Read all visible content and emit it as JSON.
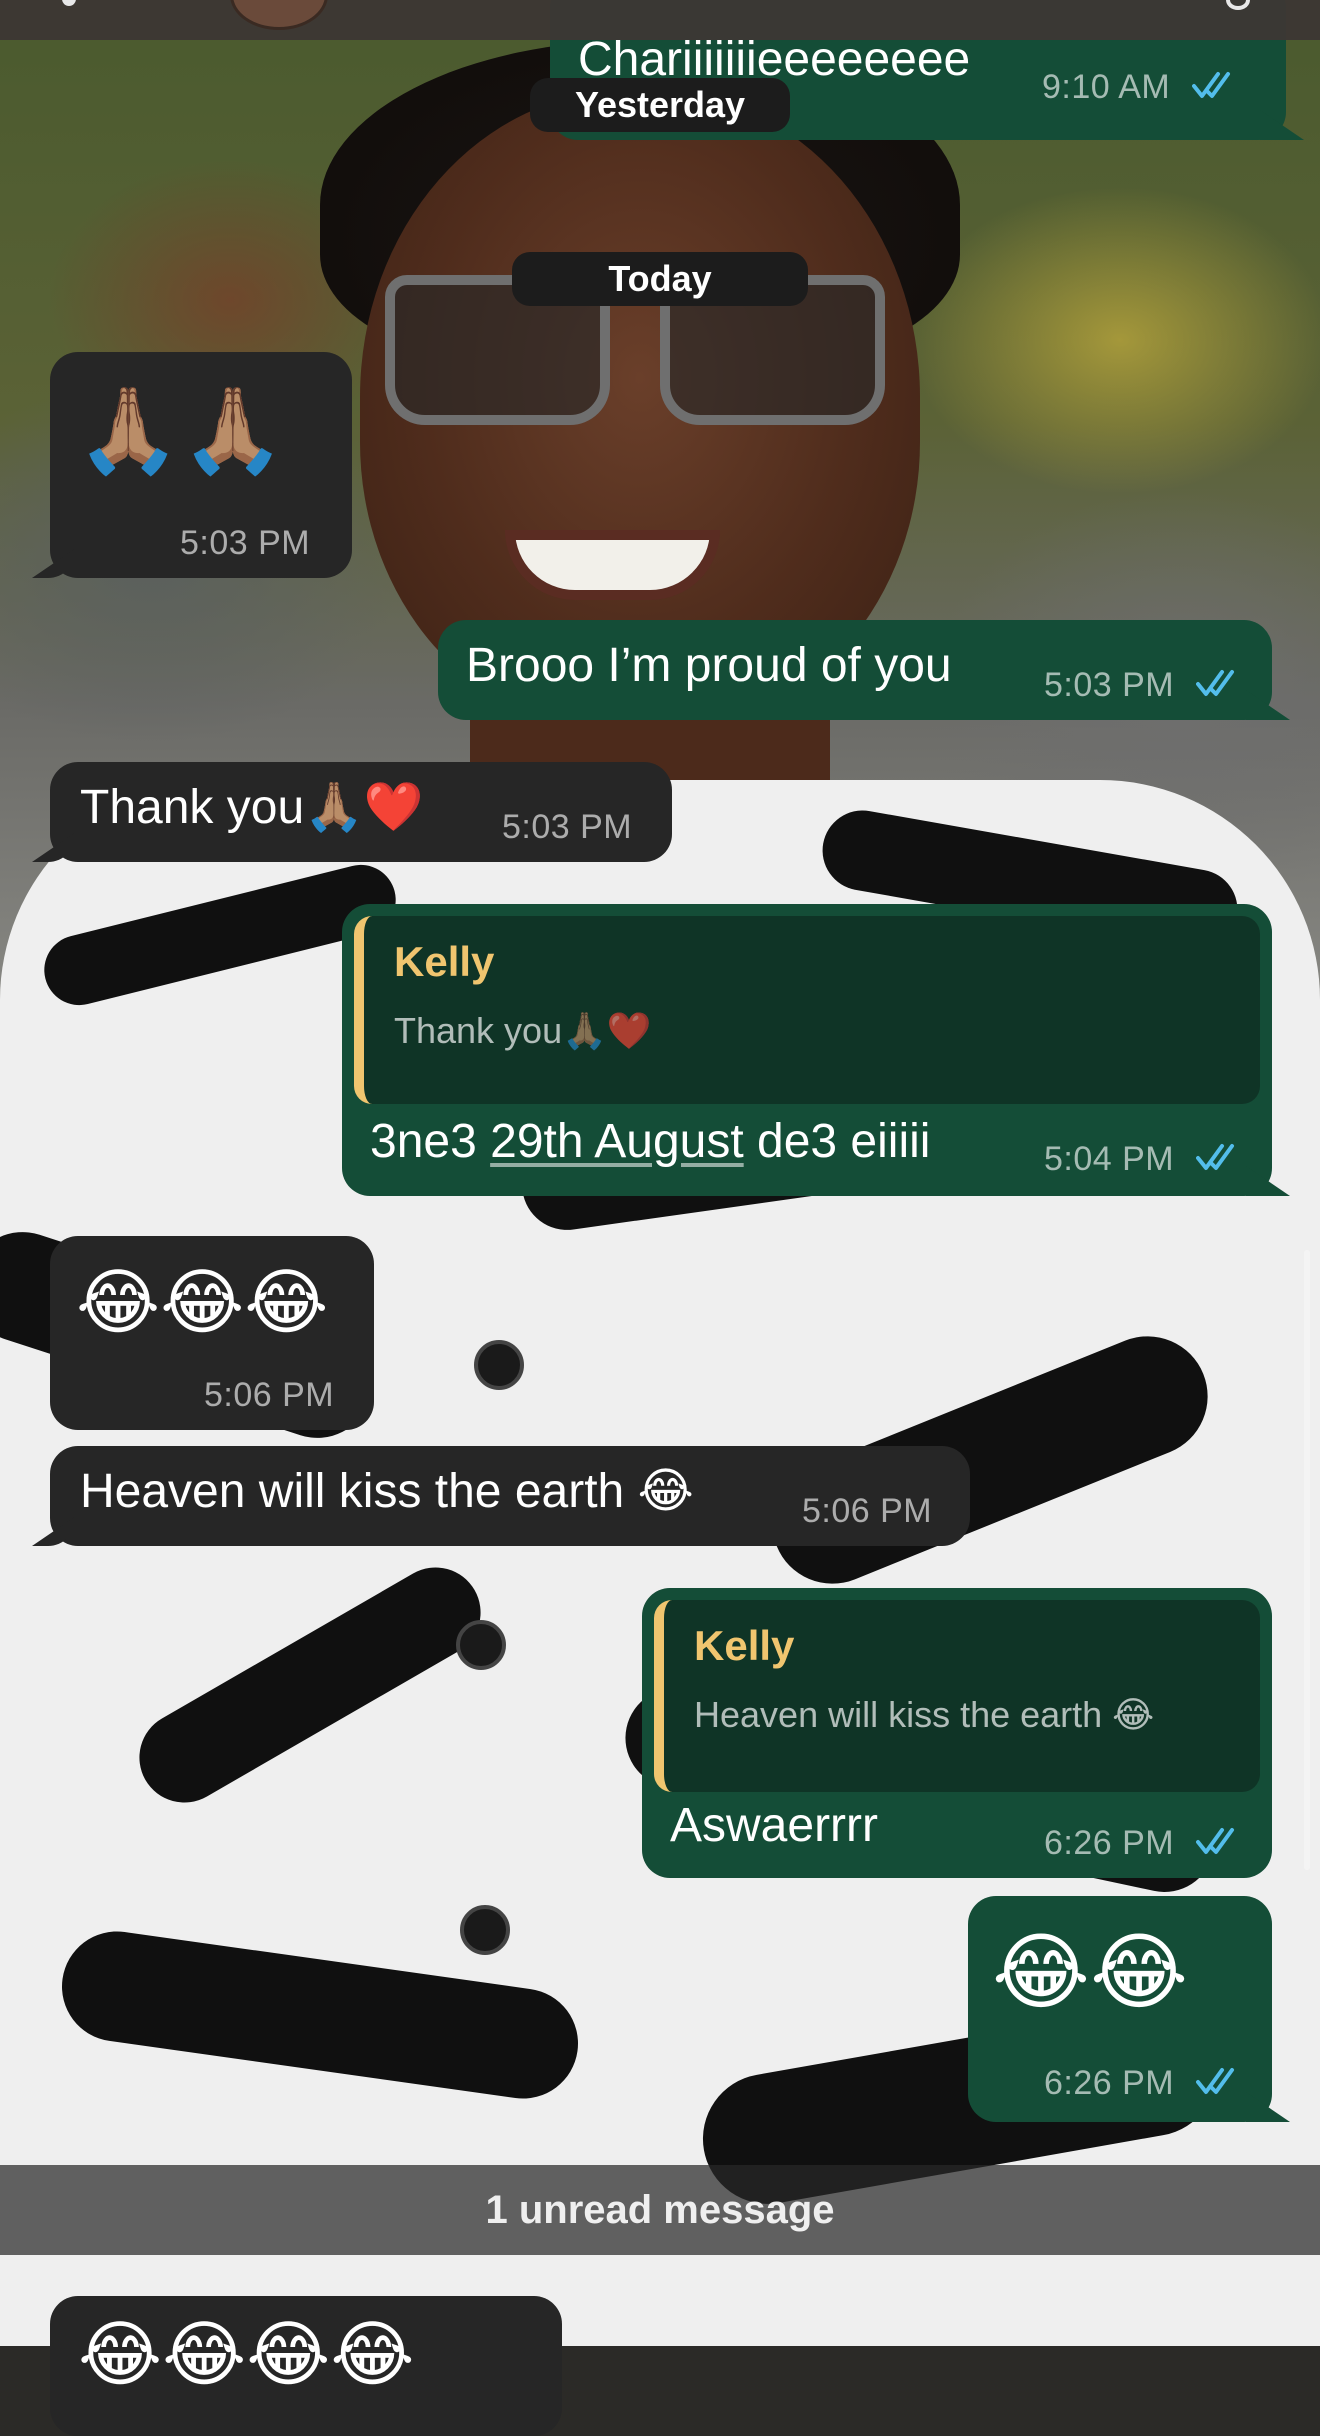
{
  "chat": {
    "contact_name": "Kelly",
    "date_separators": {
      "yesterday": "Yesterday",
      "today": "Today"
    },
    "messages": [
      {
        "id": "m0",
        "direction": "out",
        "text": "Chariiiiiiieeeeeeee",
        "time": "9:10 AM",
        "status": "read"
      },
      {
        "id": "m1",
        "direction": "in",
        "text": "🙏🏽🙏🏽",
        "time": "5:03 PM"
      },
      {
        "id": "m2",
        "direction": "out",
        "text": "Brooo I’m proud of you",
        "time": "5:03 PM",
        "status": "read"
      },
      {
        "id": "m3",
        "direction": "in",
        "text": "Thank you🙏🏽❤️",
        "time": "5:03 PM"
      },
      {
        "id": "m4",
        "direction": "out",
        "reply_to": {
          "name": "Kelly",
          "text": "Thank you🙏🏽❤️"
        },
        "text_before": "3ne3 ",
        "text_link": "29th August",
        "text_after": " de3 eiiiii",
        "time": "5:04 PM",
        "status": "read"
      },
      {
        "id": "m5",
        "direction": "in",
        "text": "😂😂😂",
        "time": "5:06 PM"
      },
      {
        "id": "m6",
        "direction": "in",
        "text": "Heaven will kiss the earth 😂",
        "time": "5:06 PM"
      },
      {
        "id": "m7",
        "direction": "out",
        "reply_to": {
          "name": "Kelly",
          "text": "Heaven will kiss the earth 😂"
        },
        "text": "Aswaerrrr",
        "time": "6:26 PM",
        "status": "read"
      },
      {
        "id": "m8",
        "direction": "out",
        "text": "😂😂",
        "time": "6:26 PM",
        "status": "read"
      },
      {
        "id": "m9",
        "direction": "in",
        "text": "😂😂😂😂"
      }
    ],
    "unread_banner": "1 unread message"
  },
  "colors": {
    "incoming_bubble": "#262626",
    "outgoing_bubble": "#144d37",
    "quote_accent": "#f0c56f",
    "read_ticks": "#53bdeb"
  },
  "icons": {
    "read_receipt": "double-check-icon",
    "back": "chevron-left-icon",
    "call": "phone-icon"
  }
}
